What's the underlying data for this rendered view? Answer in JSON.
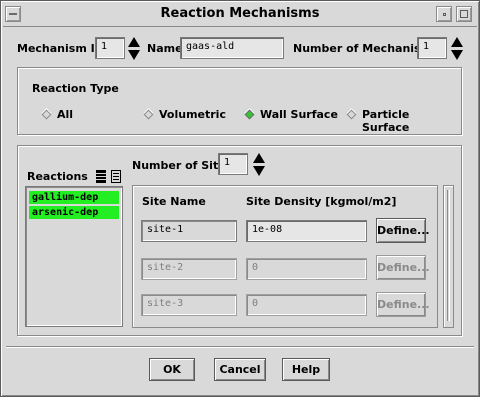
{
  "window": {
    "title": "Reaction Mechanisms"
  },
  "top_row": {
    "mechanism_id_label": "Mechanism ID",
    "mechanism_id_value": "1",
    "name_label": "Name",
    "name_value": "gaas-ald",
    "num_mechanisms_label": "Number of Mechanisms",
    "num_mechanisms_value": "1"
  },
  "reaction_type": {
    "label": "Reaction Type",
    "options": [
      {
        "label": "All",
        "selected": false
      },
      {
        "label": "Volumetric",
        "selected": false
      },
      {
        "label": "Wall Surface",
        "selected": true
      },
      {
        "label": "Particle Surface",
        "selected": false
      }
    ]
  },
  "reactions": {
    "label": "Reactions",
    "items": [
      "gallium-dep",
      "arsenic-dep"
    ],
    "highlight_color": "#22ee22"
  },
  "sites": {
    "num_sites_label": "Number of Sites",
    "num_sites_value": "1",
    "col_site_name": "Site Name",
    "col_site_density": "Site Density [kgmol/m2]",
    "rows": [
      {
        "name": "site-1",
        "density": "1e-08",
        "define": "Define...",
        "enabled": true
      },
      {
        "name": "site-2",
        "density": "0",
        "define": "Define...",
        "enabled": false
      },
      {
        "name": "site-3",
        "density": "0",
        "define": "Define...",
        "enabled": false
      }
    ]
  },
  "footer": {
    "ok": "OK",
    "cancel": "Cancel",
    "help": "Help"
  }
}
